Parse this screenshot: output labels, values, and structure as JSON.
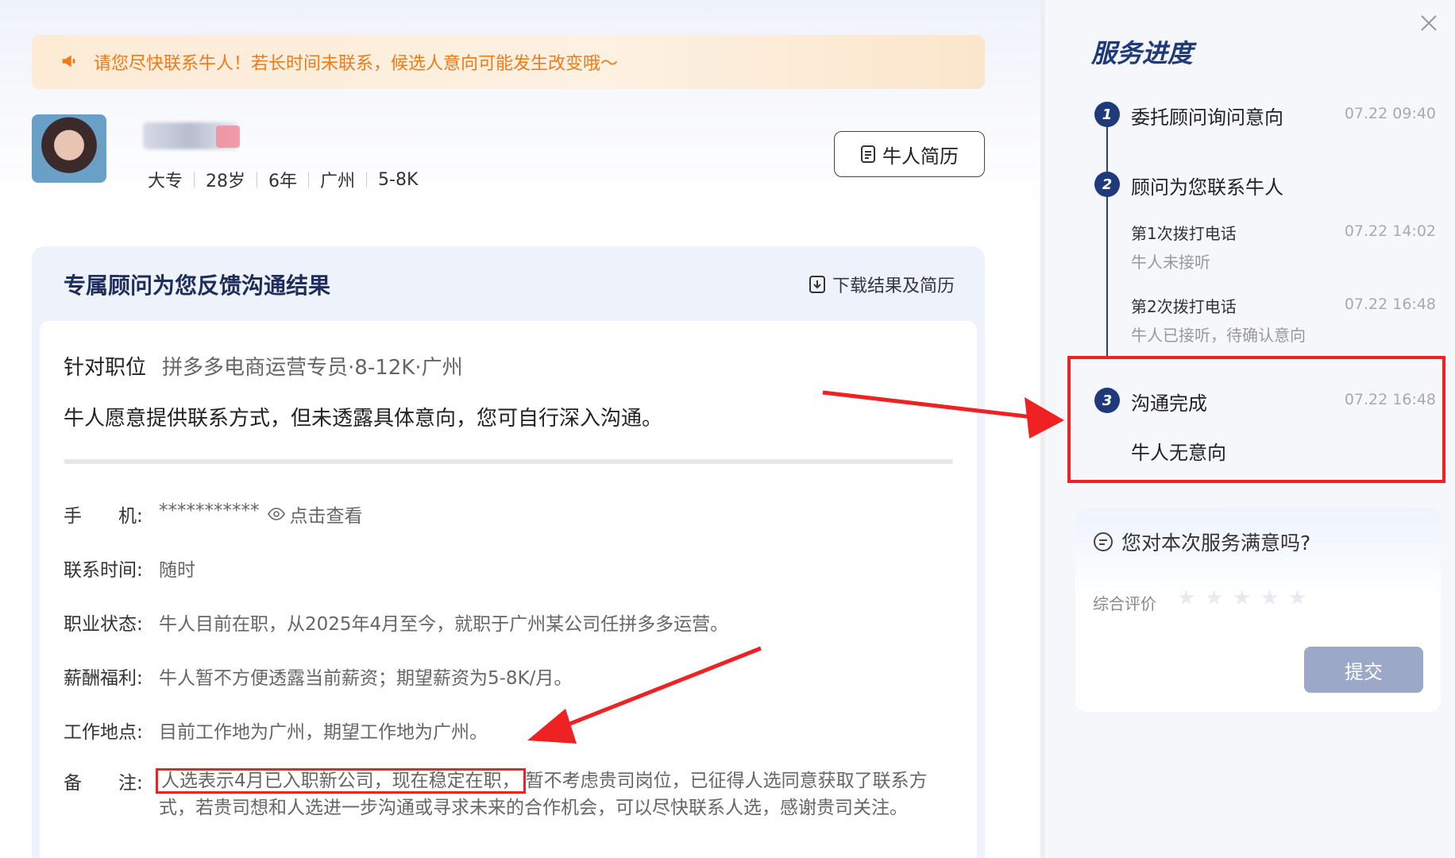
{
  "banner": {
    "text": "请您尽快联系牛人！若长时间未联系，候选人意向可能发生改变哦～"
  },
  "profile": {
    "meta": [
      "大专",
      "28岁",
      "6年",
      "广州",
      "5-8K"
    ],
    "resume_button": "牛人简历"
  },
  "feedback": {
    "title": "专属顾问为您反馈沟通结果",
    "download_label": "下载结果及简历",
    "position_label": "针对职位",
    "position_value": "拼多多电商运营专员·8-12K·广州",
    "summary": "牛人愿意提供联系方式，但未透露具体意向，您可自行深入沟通。",
    "phone_label": "手　　机:",
    "phone_value": "***********",
    "phone_reveal": "点击查看",
    "contact_time_label": "联系时间:",
    "contact_time_value": "随时",
    "status_label": "职业状态:",
    "status_value": "牛人目前在职，从2025年4月至今，就职于广州某公司任拼多多运营。",
    "salary_label": "薪酬福利:",
    "salary_value": "牛人暂不方便透露当前薪资；期望薪资为5-8K/月。",
    "location_label": "工作地点:",
    "location_value": "目前工作地为广州，期望工作地为广州。",
    "note_label": "备　　注:",
    "note_highlight": "人选表示4月已入职新公司，现在稳定在职，",
    "note_rest": "暂不考虑贵司岗位，已征得人选同意获取了联系方式，若贵司想和人选进一步沟通或寻求未来的合作机会，可以尽快联系人选，感谢贵司关注。"
  },
  "progress": {
    "title": "服务进度",
    "steps": [
      {
        "num": "1",
        "title": "委托顾问询问意向",
        "time": "07.22 09:40"
      },
      {
        "num": "2",
        "title": "顾问为您联系牛人",
        "time": "",
        "subs": [
          {
            "title": "第1次拨打电话",
            "desc": "牛人未接听",
            "time": "07.22 14:02"
          },
          {
            "title": "第2次拨打电话",
            "desc": "牛人已接听，待确认意向",
            "time": "07.22 16:48"
          }
        ]
      },
      {
        "num": "3",
        "title": "沟通完成",
        "time": "07.22 16:48",
        "result": "牛人无意向"
      }
    ]
  },
  "survey": {
    "question": "您对本次服务满意吗?",
    "rating_label": "综合评价",
    "rating_value": 0,
    "rating_max": 5,
    "submit_label": "提交"
  },
  "icons": [
    "megaphone-icon",
    "document-icon",
    "download-icon",
    "eye-icon",
    "close-icon",
    "chat-icon",
    "star-icon"
  ],
  "colors": {
    "highlight_red": "#e22222",
    "brand_navy": "#1f3a7a",
    "banner_orange": "#f07a16",
    "submit_disabled": "#9ba8c8"
  }
}
